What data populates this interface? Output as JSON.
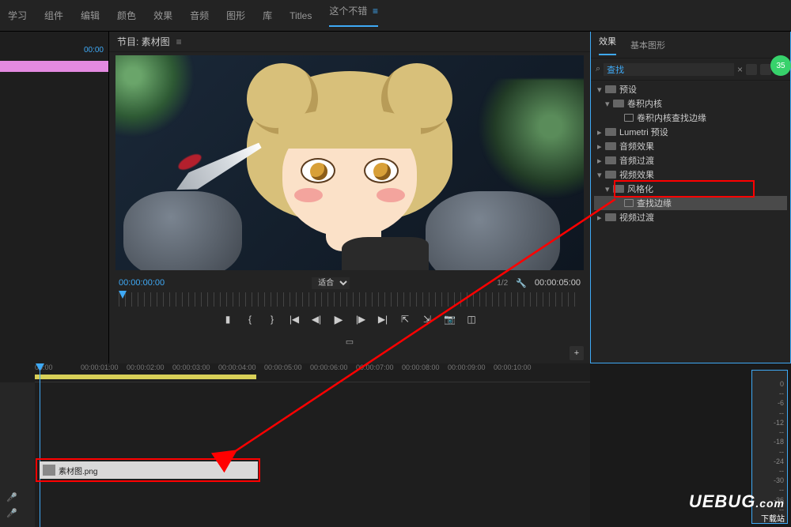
{
  "menu": {
    "items": [
      "学习",
      "组件",
      "编辑",
      "颜色",
      "效果",
      "音频",
      "图形",
      "库",
      "Titles"
    ],
    "active": "这个不错"
  },
  "program": {
    "title": "节目: 素材图",
    "tc_left": "00:00:00:00",
    "fit": "适合",
    "ratio": "1/2",
    "tc_right": "00:00:05:00"
  },
  "left": {
    "timecode": "00:00"
  },
  "effects": {
    "tabs": {
      "a": "效果",
      "b": "基本图形"
    },
    "search": "查找",
    "tree": {
      "presets": "预设",
      "conv": "卷积内核",
      "conv_find_edges": "卷积内核查找边缘",
      "lumetri": "Lumetri 预设",
      "audio_fx": "音频效果",
      "audio_tr": "音频过渡",
      "video_fx": "视频效果",
      "stylize": "风格化",
      "find_edges": "查找边缘",
      "video_tr": "视频过渡"
    }
  },
  "timeline": {
    "ticks": [
      "00:00",
      "00:00:01:00",
      "00:00:02:00",
      "00:00:03:00",
      "00:00:04:00",
      "00:00:05:00",
      "00:00:06:00",
      "00:00:07:00",
      "00:00:08:00",
      "00:00:09:00",
      "00:00:10:00"
    ],
    "clip_name": "素材图.png"
  },
  "meter_vals": [
    "0",
    "--",
    "-6",
    "--",
    "-12",
    "--",
    "-18",
    "--",
    "-24",
    "--",
    "-30",
    "--",
    "-36",
    "--"
  ],
  "avatar": "35",
  "watermark": {
    "brand": "UEBUG",
    "sub": "下载站",
    "dot": ".com"
  }
}
